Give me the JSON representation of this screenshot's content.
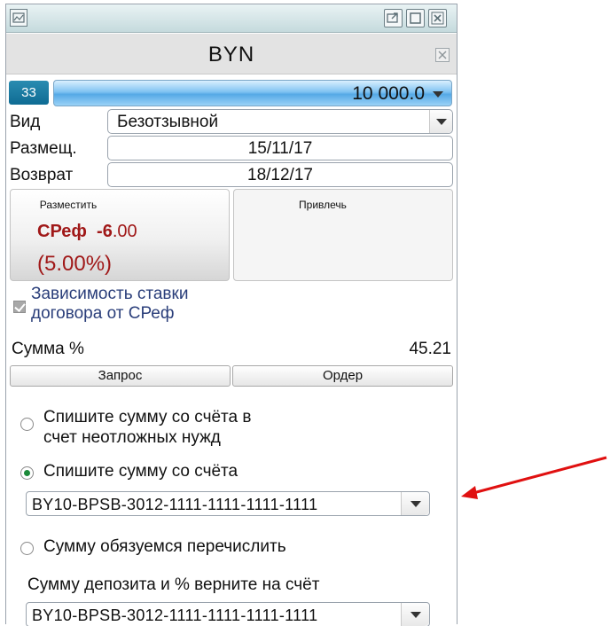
{
  "window": {
    "title": "BYN"
  },
  "amount": {
    "badge": "33",
    "value": "10 000.0"
  },
  "fields": {
    "vid": {
      "label": "Вид",
      "value": "Безотзывной"
    },
    "razmesh": {
      "label": "Размещ.",
      "value": "15/11/17"
    },
    "vozvrat": {
      "label": "Возврат",
      "value": "18/12/17"
    }
  },
  "panels": {
    "left": {
      "header": "Разместить",
      "rate_name": "СРеф",
      "rate_int": "-6",
      "rate_dec": ".00",
      "rate_pct": "(5.00%)"
    },
    "right": {
      "header": "Привлечь"
    }
  },
  "dependency": {
    "checked": true,
    "label_line1": "Зависимость ставки",
    "label_line2": "договора от СРеф"
  },
  "summa": {
    "label": "Сумма %",
    "value": "45.21"
  },
  "buttons": {
    "zapros": "Запрос",
    "order": "Ордер"
  },
  "options": {
    "opt1_line1": "Спишите сумму со счёта в",
    "opt1_line2": "счет неотложных нужд",
    "opt2": "Спишите сумму со счёта",
    "opt2_account": "BY10-BPSB-3012-1111-1111-1111-1111",
    "opt3": "Сумму обязуемся перечислить",
    "return_label": "Сумму депозита и % верните на счёт",
    "return_account": "BY10-BPSB-3012-1111-1111-1111-1111",
    "selected": "opt2"
  },
  "colors": {
    "rate": "#a01818",
    "accent": "#0e6b93",
    "annotation_arrow": "#e01010"
  }
}
